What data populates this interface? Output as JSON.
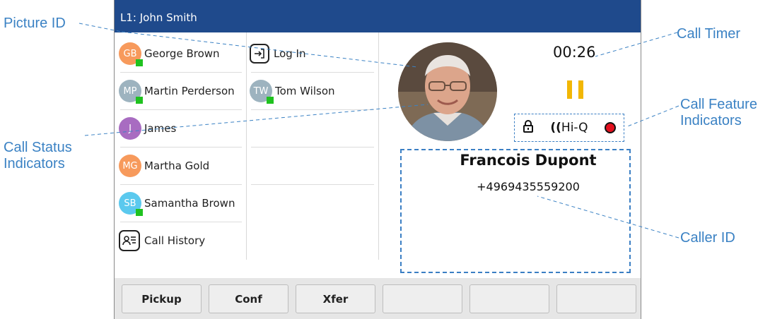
{
  "title_bar": {
    "text": "L1: John Smith"
  },
  "contacts_left": [
    {
      "initials": "GB",
      "name": "George Brown",
      "color": "#f79a5c",
      "status": true
    },
    {
      "initials": "MP",
      "name": "Martin Perderson",
      "color": "#9db3bf",
      "status": true
    },
    {
      "initials": "J",
      "name": "James",
      "color": "#a86cc1",
      "status": false
    },
    {
      "initials": "MG",
      "name": "Martha Gold",
      "color": "#f79a5c",
      "status": false
    },
    {
      "initials": "SB",
      "name": "Samantha Brown",
      "color": "#5bc9ee",
      "status": true
    }
  ],
  "call_history": {
    "label": "Call History",
    "icon": "call-history-icon"
  },
  "contacts_mid": [
    {
      "type": "icon",
      "label": "Log In",
      "icon": "login-icon"
    },
    {
      "initials": "TW",
      "name": "Tom Wilson",
      "color": "#9db3bf",
      "status": true
    }
  ],
  "call": {
    "timer": "00:26",
    "status_icon": "pause-icon",
    "features": [
      "lock-icon",
      "Hi-Q",
      "record-icon"
    ],
    "hiq_label": "Hi-Q",
    "caller_name": "Francois Dupont",
    "caller_number": "+4969435559200"
  },
  "softkeys": [
    "Pickup",
    "Conf",
    "Xfer",
    "",
    "",
    ""
  ],
  "callouts": {
    "picture_id": "Picture ID",
    "call_status_1": "Call Status",
    "call_status_2": "Indicators",
    "call_timer": "Call Timer",
    "call_feature_1": "Call Feature",
    "call_feature_2": "Indicators",
    "caller_id": "Caller ID"
  },
  "colors": {
    "title_bg": "#1f4a8c",
    "callout": "#3b82c4",
    "status_green": "#1fc21f",
    "pause_yellow": "#f2b705",
    "record_red": "#e3101e"
  }
}
